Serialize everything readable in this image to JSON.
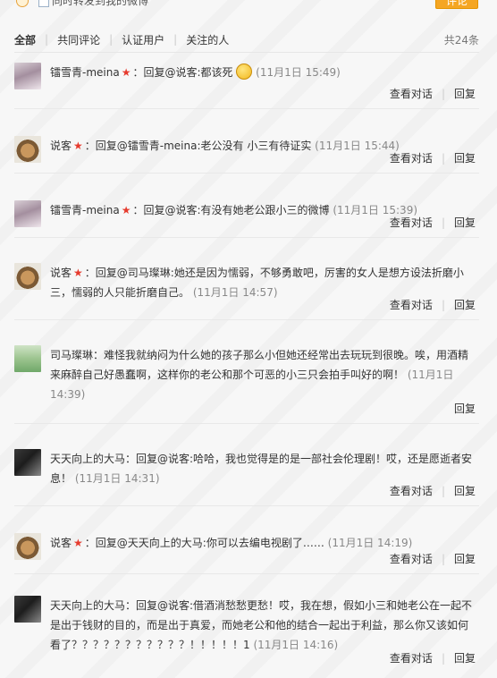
{
  "topbar": {
    "forward_label": "同时转发到我的微博",
    "submit_label": "评论"
  },
  "filters": {
    "tabs": [
      "全部",
      "共同评论",
      "认证用户",
      "关注的人"
    ],
    "total": "共24条"
  },
  "actions": {
    "view": "查看对话",
    "reply": "回复"
  },
  "comments": [
    {
      "name": "镭雪青-meina",
      "crown": "★",
      "text": "：回复@说客:都该死",
      "time": "(11月1日 15:49)",
      "avatar": "girl"
    },
    {
      "name": "说客",
      "crown": "★",
      "text": "：回复@镭雪青-meina:老公没有 小三有待证实",
      "time": "(11月1日 15:44)",
      "avatar": "dog"
    },
    {
      "name": "镭雪青-meina",
      "crown": "★",
      "text": "：回复@说客:有没有她老公跟小三的微博",
      "time": "(11月1日 15:39)",
      "avatar": "girl"
    },
    {
      "name": "说客",
      "crown": "★",
      "text": "：回复@司马璨琳:她还是因为懦弱，不够勇敢吧，厉害的女人是想方设法折磨小三，懦弱的人只能折磨自己。",
      "time": "(11月1日 14:57)",
      "avatar": "dog"
    },
    {
      "name": "司马璨琳",
      "crown": "",
      "text": "：难怪我就纳闷为什么她的孩子那么小但她还经常出去玩玩到很晚。唉，用酒精来麻醉自己好愚蠢啊，这样你的老公和那个可恶的小三只会拍手叫好的啊！",
      "time": "(11月1日 14:39)",
      "avatar": "cat"
    },
    {
      "name": "天天向上的大马",
      "crown": "",
      "text": "：回复@说客:哈哈，我也觉得是的是一部社会伦理剧！哎，还是愿逝者安息！",
      "time": "(11月1日 14:31)",
      "avatar": "bw"
    },
    {
      "name": "说客",
      "crown": "★",
      "text": "：回复@天天向上的大马:你可以去编电视剧了……",
      "time": "(11月1日 14:19)",
      "avatar": "dog"
    },
    {
      "name": "天天向上的大马",
      "crown": "",
      "text": "：回复@说客:借酒消愁愁更愁！哎，我在想，假如小三和她老公在一起不是出于钱财的目的，而是出于真爱，而她老公和他的结合一起出于利益，那么你又该如何看了？？？？？？？？？？？！！！！！1",
      "time": "(11月1日 14:16)",
      "avatar": "bw"
    }
  ]
}
